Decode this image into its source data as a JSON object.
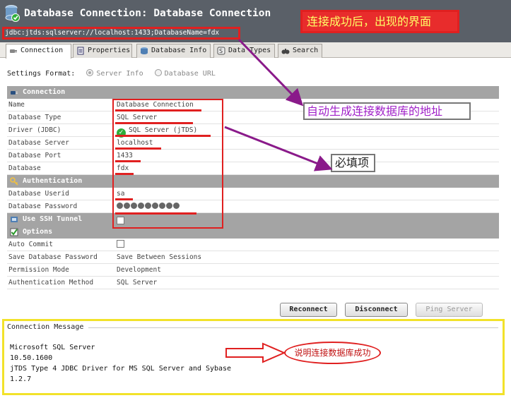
{
  "window": {
    "title": "Database Connection: Database Connection",
    "url": "jdbc:jtds:sqlserver://localhost:1433;DatabaseName=fdx"
  },
  "tabs": [
    {
      "label": "Connection",
      "icon": "plug-icon",
      "active": true
    },
    {
      "label": "Properties",
      "icon": "properties-icon",
      "active": false
    },
    {
      "label": "Database Info",
      "icon": "database-icon",
      "active": false
    },
    {
      "label": "Data Types",
      "icon": "datatypes-icon",
      "active": false
    },
    {
      "label": "Search",
      "icon": "binoculars-icon",
      "active": false
    }
  ],
  "settings_format": {
    "label": "Settings Format:",
    "options": [
      "Server Info",
      "Database URL"
    ],
    "selected": "Server Info"
  },
  "sections": {
    "connection": {
      "title": "Connection",
      "rows": [
        {
          "key": "Name",
          "value": "Database Connection"
        },
        {
          "key": "Database Type",
          "value": "SQL Server"
        },
        {
          "key": "Driver (JDBC)",
          "value": "SQL Server (jTDS)"
        },
        {
          "key": "Database Server",
          "value": "localhost"
        },
        {
          "key": "Database Port",
          "value": "1433"
        },
        {
          "key": "Database",
          "value": "fdx"
        }
      ]
    },
    "authentication": {
      "title": "Authentication",
      "rows": [
        {
          "key": "Database Userid",
          "value": "sa"
        },
        {
          "key": "Database Password",
          "value": "",
          "masked_length": 9
        }
      ]
    },
    "ssh": {
      "title": "Use SSH Tunnel",
      "checked": false
    },
    "options": {
      "title": "Options",
      "rows": [
        {
          "key": "Auto Commit",
          "value": "",
          "checked": false
        },
        {
          "key": "Save Database Password",
          "value": "Save Between Sessions"
        },
        {
          "key": "Permission Mode",
          "value": "Development"
        },
        {
          "key": "Authentication Method",
          "value": "SQL Server"
        }
      ]
    }
  },
  "buttons": {
    "reconnect": "Reconnect",
    "disconnect": "Disconnect",
    "ping": "Ping Server"
  },
  "connection_message": {
    "label": "Connection Message",
    "lines": [
      "Microsoft SQL Server",
      "10.50.1600",
      "jTDS Type 4 JDBC Driver for MS SQL Server and Sybase",
      "1.2.7"
    ]
  },
  "annotations": {
    "success_screen": "连接成功后，出现的界面",
    "auto_url": "自动生成连接数据库的地址",
    "required": "必填项",
    "success_note": "说明连接数据库成功"
  },
  "colors": {
    "annotation_red": "#e02020",
    "annotation_purple": "#8a1a8a",
    "message_outline": "#f2e22a",
    "section_header": "#a4a4a4"
  }
}
